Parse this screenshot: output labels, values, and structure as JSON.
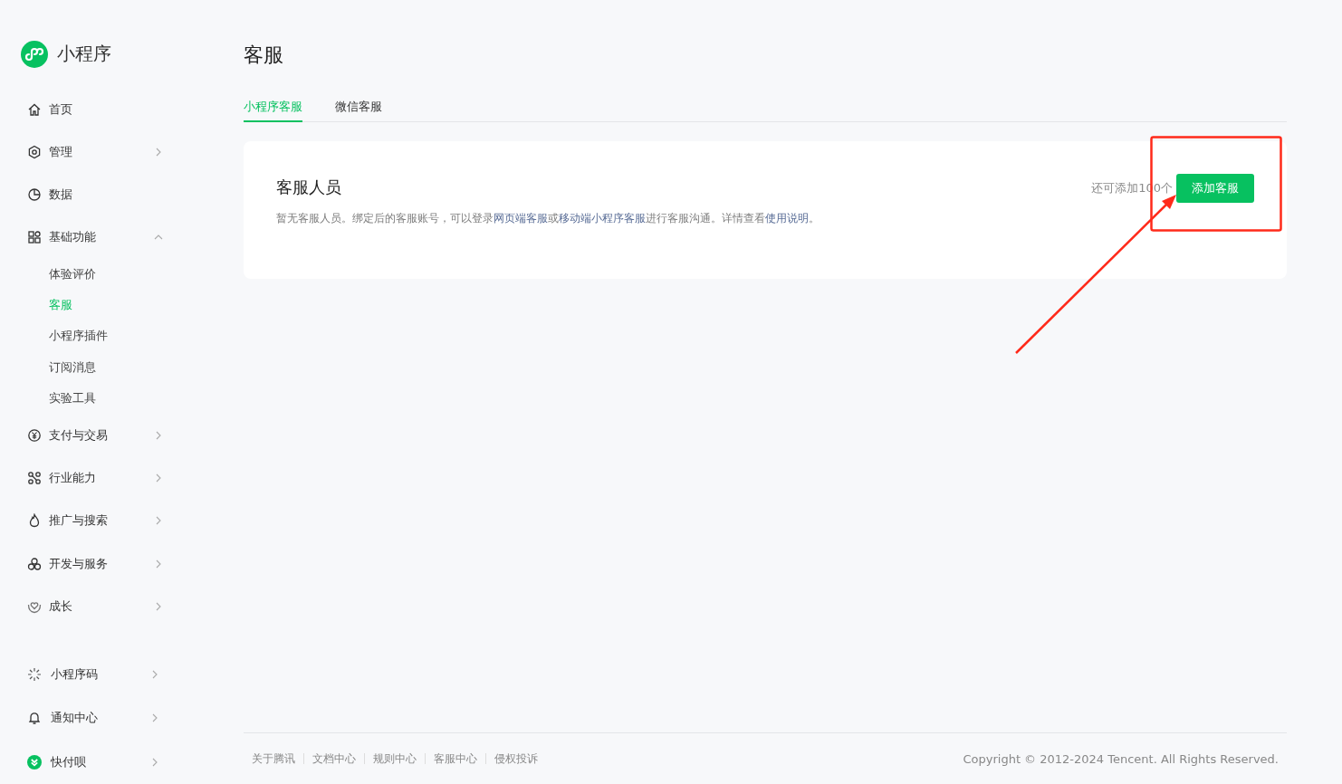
{
  "brand": {
    "name": "小程序"
  },
  "sidebar": {
    "items": [
      {
        "label": "首页"
      },
      {
        "label": "管理",
        "expanded": false
      },
      {
        "label": "数据"
      },
      {
        "label": "基础功能",
        "expanded": true,
        "children": [
          {
            "label": "体验评价",
            "selected": false
          },
          {
            "label": "客服",
            "selected": true
          },
          {
            "label": "小程序插件",
            "selected": false
          },
          {
            "label": "订阅消息",
            "selected": false
          },
          {
            "label": "实验工具",
            "selected": false
          }
        ]
      },
      {
        "label": "支付与交易",
        "expanded": false
      },
      {
        "label": "行业能力",
        "expanded": false
      },
      {
        "label": "推广与搜索",
        "expanded": false
      },
      {
        "label": "开发与服务",
        "expanded": false
      },
      {
        "label": "成长",
        "expanded": false
      }
    ],
    "bottom_items": [
      {
        "label": "小程序码",
        "expanded": false
      },
      {
        "label": "通知中心",
        "expanded": false
      },
      {
        "label": "快付呗",
        "expanded": false
      }
    ]
  },
  "page": {
    "title": "客服",
    "tabs": [
      {
        "label": "小程序客服",
        "selected": true
      },
      {
        "label": "微信客服",
        "selected": false
      }
    ],
    "card": {
      "heading": "客服人员",
      "description": [
        {
          "text": "暂无客服人员。绑定后的客服账号，可以登录",
          "link": false
        },
        {
          "text": "网页端客服",
          "link": true
        },
        {
          "text": "或",
          "link": false
        },
        {
          "text": "移动端小程序客服",
          "link": true
        },
        {
          "text": "进行客服沟通。详情查看",
          "link": false
        },
        {
          "text": "使用说明",
          "link": true
        },
        {
          "text": "。",
          "link": false
        }
      ],
      "quota": "还可添加100个",
      "add_button": "添加客服"
    }
  },
  "footer": {
    "links": [
      "关于腾讯",
      "文档中心",
      "规则中心",
      "客服中心",
      "侵权投诉"
    ],
    "copyright": "Copyright © 2012-2024 Tencent. All Rights Reserved."
  }
}
